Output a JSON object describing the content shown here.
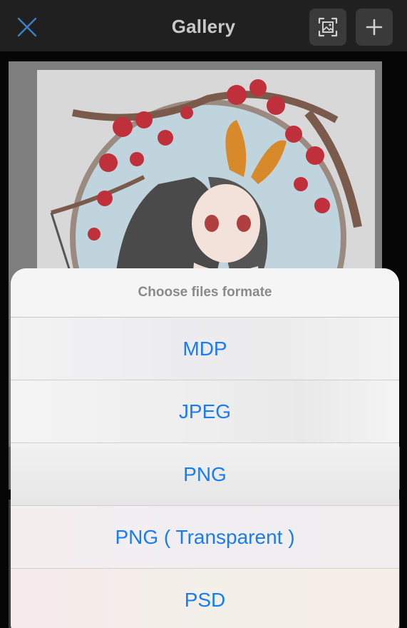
{
  "topbar": {
    "title": "Gallery",
    "icons": {
      "close": "close-icon",
      "image_select": "image-select-icon",
      "add": "plus-icon"
    },
    "colors": {
      "close_icon": "#3b7fc4",
      "title": "#c8c8c8",
      "background": "#202020"
    }
  },
  "gallery": {
    "artwork_icon": "artwork-thumbnail"
  },
  "sheet": {
    "title": "Choose files formate",
    "options": [
      {
        "label": "MDP"
      },
      {
        "label": "JPEG"
      },
      {
        "label": "PNG"
      },
      {
        "label": "PNG ( Transparent )"
      },
      {
        "label": "PSD"
      }
    ],
    "colors": {
      "option_text": "#1a7cf0",
      "title_text": "#8a8a8a"
    }
  }
}
